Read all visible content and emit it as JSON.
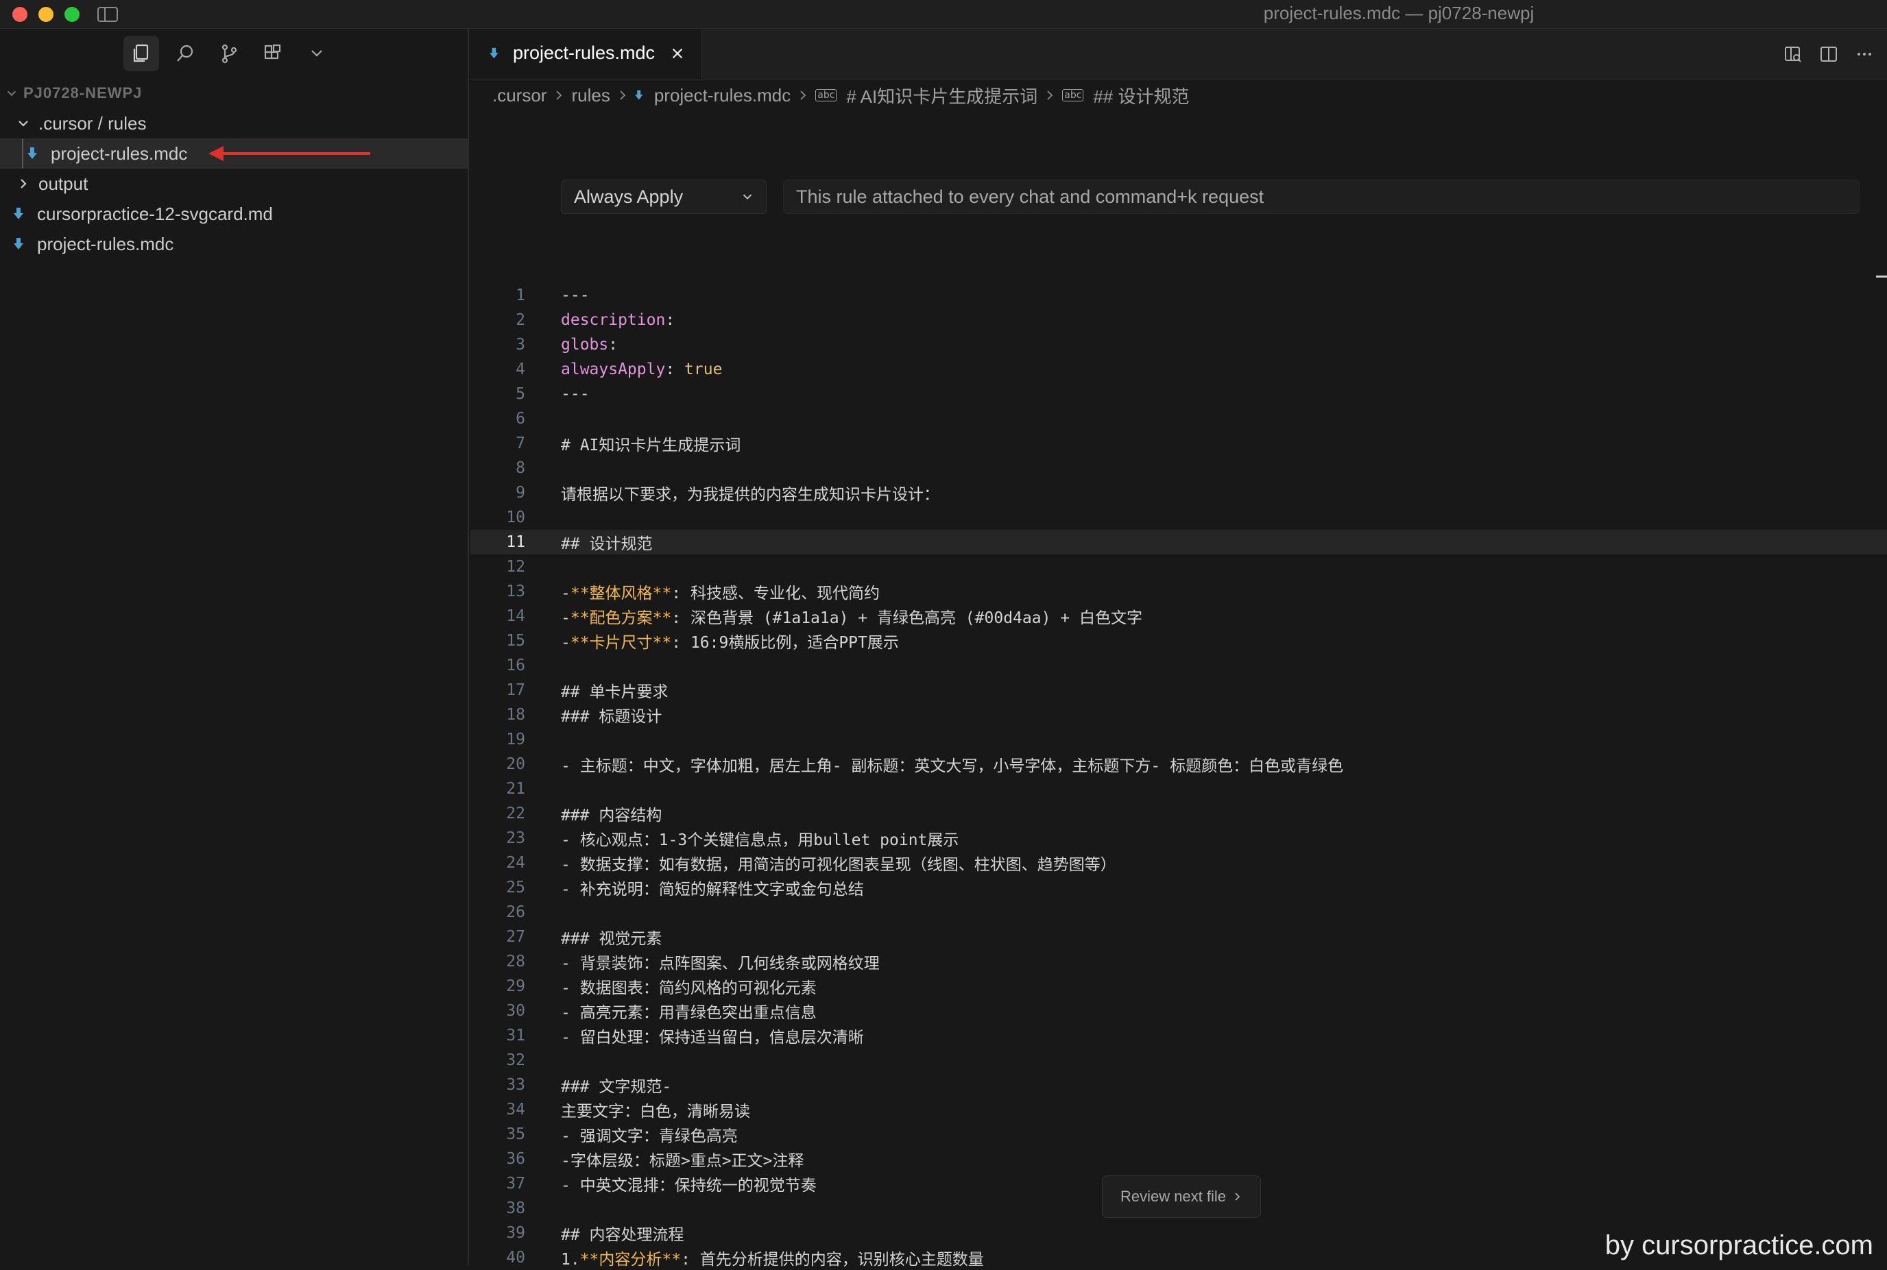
{
  "window": {
    "title": "project-rules.mdc — pj0728-newpj"
  },
  "sidebar": {
    "workspace": "PJ0728-NEWPJ",
    "tree": [
      {
        "label": ".cursor / rules",
        "type": "folder",
        "expanded": true
      },
      {
        "label": "project-rules.mdc",
        "type": "file",
        "selected": true
      },
      {
        "label": "output",
        "type": "folder",
        "expanded": false
      },
      {
        "label": "cursorpractice-12-svgcard.md",
        "type": "file"
      },
      {
        "label": "project-rules.mdc",
        "type": "file"
      }
    ],
    "icons": [
      "files-icon",
      "search-icon",
      "source-control-icon",
      "extensions-icon",
      "chevron-down-icon"
    ]
  },
  "tab": {
    "label": "project-rules.mdc"
  },
  "breadcrumb": {
    "items": [
      ".cursor",
      "rules",
      "project-rules.mdc",
      "# AI知识卡片生成提示词",
      "## 设计规范"
    ]
  },
  "rule": {
    "mode": "Always Apply",
    "description": "This rule attached to every chat and command+k request"
  },
  "code": {
    "current_line": 11,
    "lines": [
      "---",
      "description:",
      "globs:",
      "alwaysApply: true",
      "---",
      "",
      "# AI知识卡片生成提示词",
      "",
      "请根据以下要求，为我提供的内容生成知识卡片设计：",
      "",
      "## 设计规范",
      "",
      "-**整体风格**: 科技感、专业化、现代简约",
      "-**配色方案**: 深色背景 (#1a1a1a) + 青绿色高亮 (#00d4aa) + 白色文字",
      "-**卡片尺寸**: 16:9横版比例，适合PPT展示",
      "",
      "## 单卡片要求",
      "### 标题设计",
      "",
      "- 主标题：中文，字体加粗，居左上角- 副标题：英文大写，小号字体，主标题下方- 标题颜色：白色或青绿色",
      "",
      "### 内容结构",
      "- 核心观点：1-3个关键信息点，用bullet point展示",
      "- 数据支撑：如有数据，用简洁的可视化图表呈现（线图、柱状图、趋势图等）",
      "- 补充说明：简短的解释性文字或金句总结",
      "",
      "### 视觉元素",
      "- 背景装饰：点阵图案、几何线条或网格纹理",
      "- 数据图表：简约风格的可视化元素",
      "- 高亮元素：用青绿色突出重点信息",
      "- 留白处理：保持适当留白，信息层次清晰",
      "",
      "### 文字规范-",
      "主要文字：白色，清晰易读",
      "- 强调文字：青绿色高亮",
      "-字体层级：标题>重点>正文>注释",
      "- 中英文混排：保持统一的视觉节奏",
      "",
      "## 内容处理流程",
      "1.**内容分析**: 首先分析提供的内容，识别核心主题数量"
    ]
  },
  "review": {
    "label": "Review next file"
  },
  "watermark": "by cursorpractice.com",
  "colors": {
    "background": "#181818",
    "key": "#e394dc",
    "bold_marker": "#f1b84f",
    "accent_red": "#e0302a"
  }
}
